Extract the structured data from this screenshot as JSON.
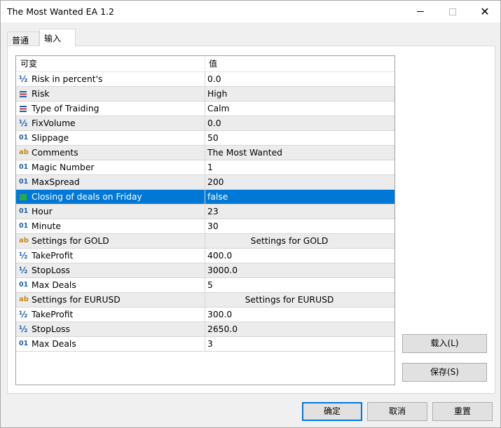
{
  "window": {
    "title": "The Most Wanted EA 1.2"
  },
  "tabs": [
    {
      "label": "普通"
    },
    {
      "label": "输入"
    }
  ],
  "grid": {
    "headers": {
      "variable": "可变",
      "value": "值"
    },
    "rows": [
      {
        "icon": "fraction-icon",
        "name": "Risk in percent's",
        "value": "0.0"
      },
      {
        "icon": "enum-icon",
        "name": "Risk",
        "value": "High"
      },
      {
        "icon": "enum-icon",
        "name": "Type of Traiding",
        "value": "Calm"
      },
      {
        "icon": "fraction-icon",
        "name": "FixVolume",
        "value": "0.0"
      },
      {
        "icon": "integer-icon",
        "name": "Slippage",
        "value": "50"
      },
      {
        "icon": "string-icon",
        "name": "Comments",
        "value": "The Most Wanted"
      },
      {
        "icon": "integer-icon",
        "name": "Magic Number",
        "value": "1"
      },
      {
        "icon": "integer-icon",
        "name": "MaxSpread",
        "value": "200"
      },
      {
        "icon": "bool-icon",
        "name": "Closing of deals on Friday",
        "value": "false"
      },
      {
        "icon": "integer-icon",
        "name": "Hour",
        "value": "23"
      },
      {
        "icon": "integer-icon",
        "name": "Minute",
        "value": "30"
      },
      {
        "icon": "string-icon",
        "name": "Settings for GOLD",
        "value": "Settings for GOLD"
      },
      {
        "icon": "fraction-icon",
        "name": "TakeProfit",
        "value": "400.0"
      },
      {
        "icon": "fraction-icon",
        "name": "StopLoss",
        "value": "3000.0"
      },
      {
        "icon": "integer-icon",
        "name": "Max Deals",
        "value": "5"
      },
      {
        "icon": "string-icon",
        "name": "Settings for EURUSD",
        "value": "Settings for EURUSD"
      },
      {
        "icon": "fraction-icon",
        "name": "TakeProfit",
        "value": "300.0"
      },
      {
        "icon": "fraction-icon",
        "name": "StopLoss",
        "value": "2650.0"
      },
      {
        "icon": "integer-icon",
        "name": "Max Deals",
        "value": "3"
      }
    ]
  },
  "buttons": {
    "load": "载入(L)",
    "save": "保存(S)",
    "ok": "确定",
    "cancel": "取消",
    "reset": "重置"
  },
  "colors": {
    "selection": "#0078d7",
    "integer_icon": "#1f5fae",
    "string_icon": "#c8861a"
  }
}
